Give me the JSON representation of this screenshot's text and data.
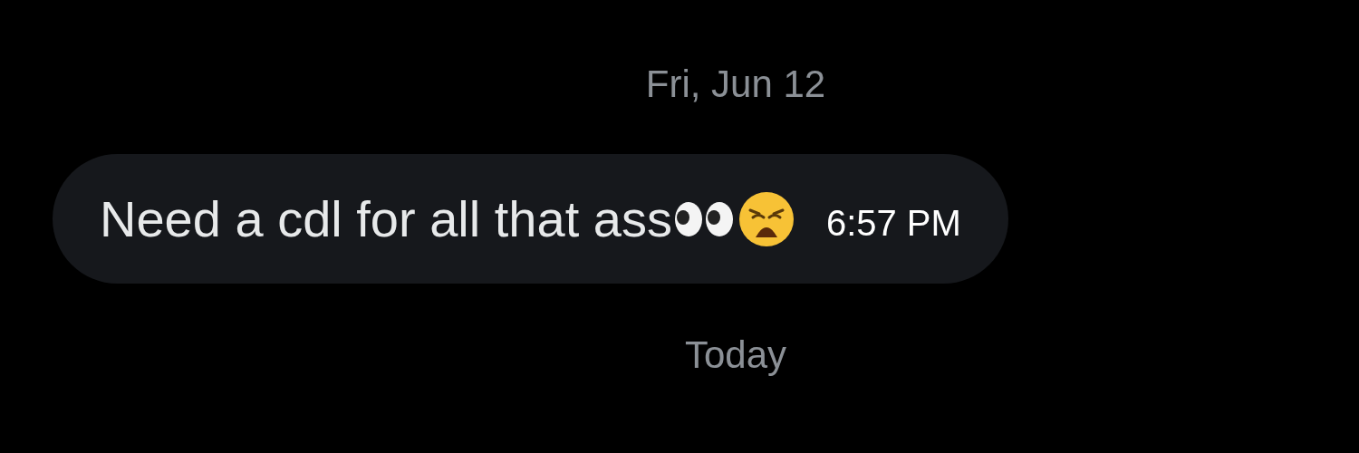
{
  "messages": [
    {
      "kind": "date",
      "text": "Fri, Jun 12"
    },
    {
      "kind": "bubble",
      "text": "Need a cdl for all that ass",
      "emojis": [
        {
          "kind": "eyes"
        },
        {
          "kind": "weary"
        }
      ],
      "time": "6:57 PM"
    },
    {
      "kind": "date",
      "text": "Today"
    }
  ]
}
